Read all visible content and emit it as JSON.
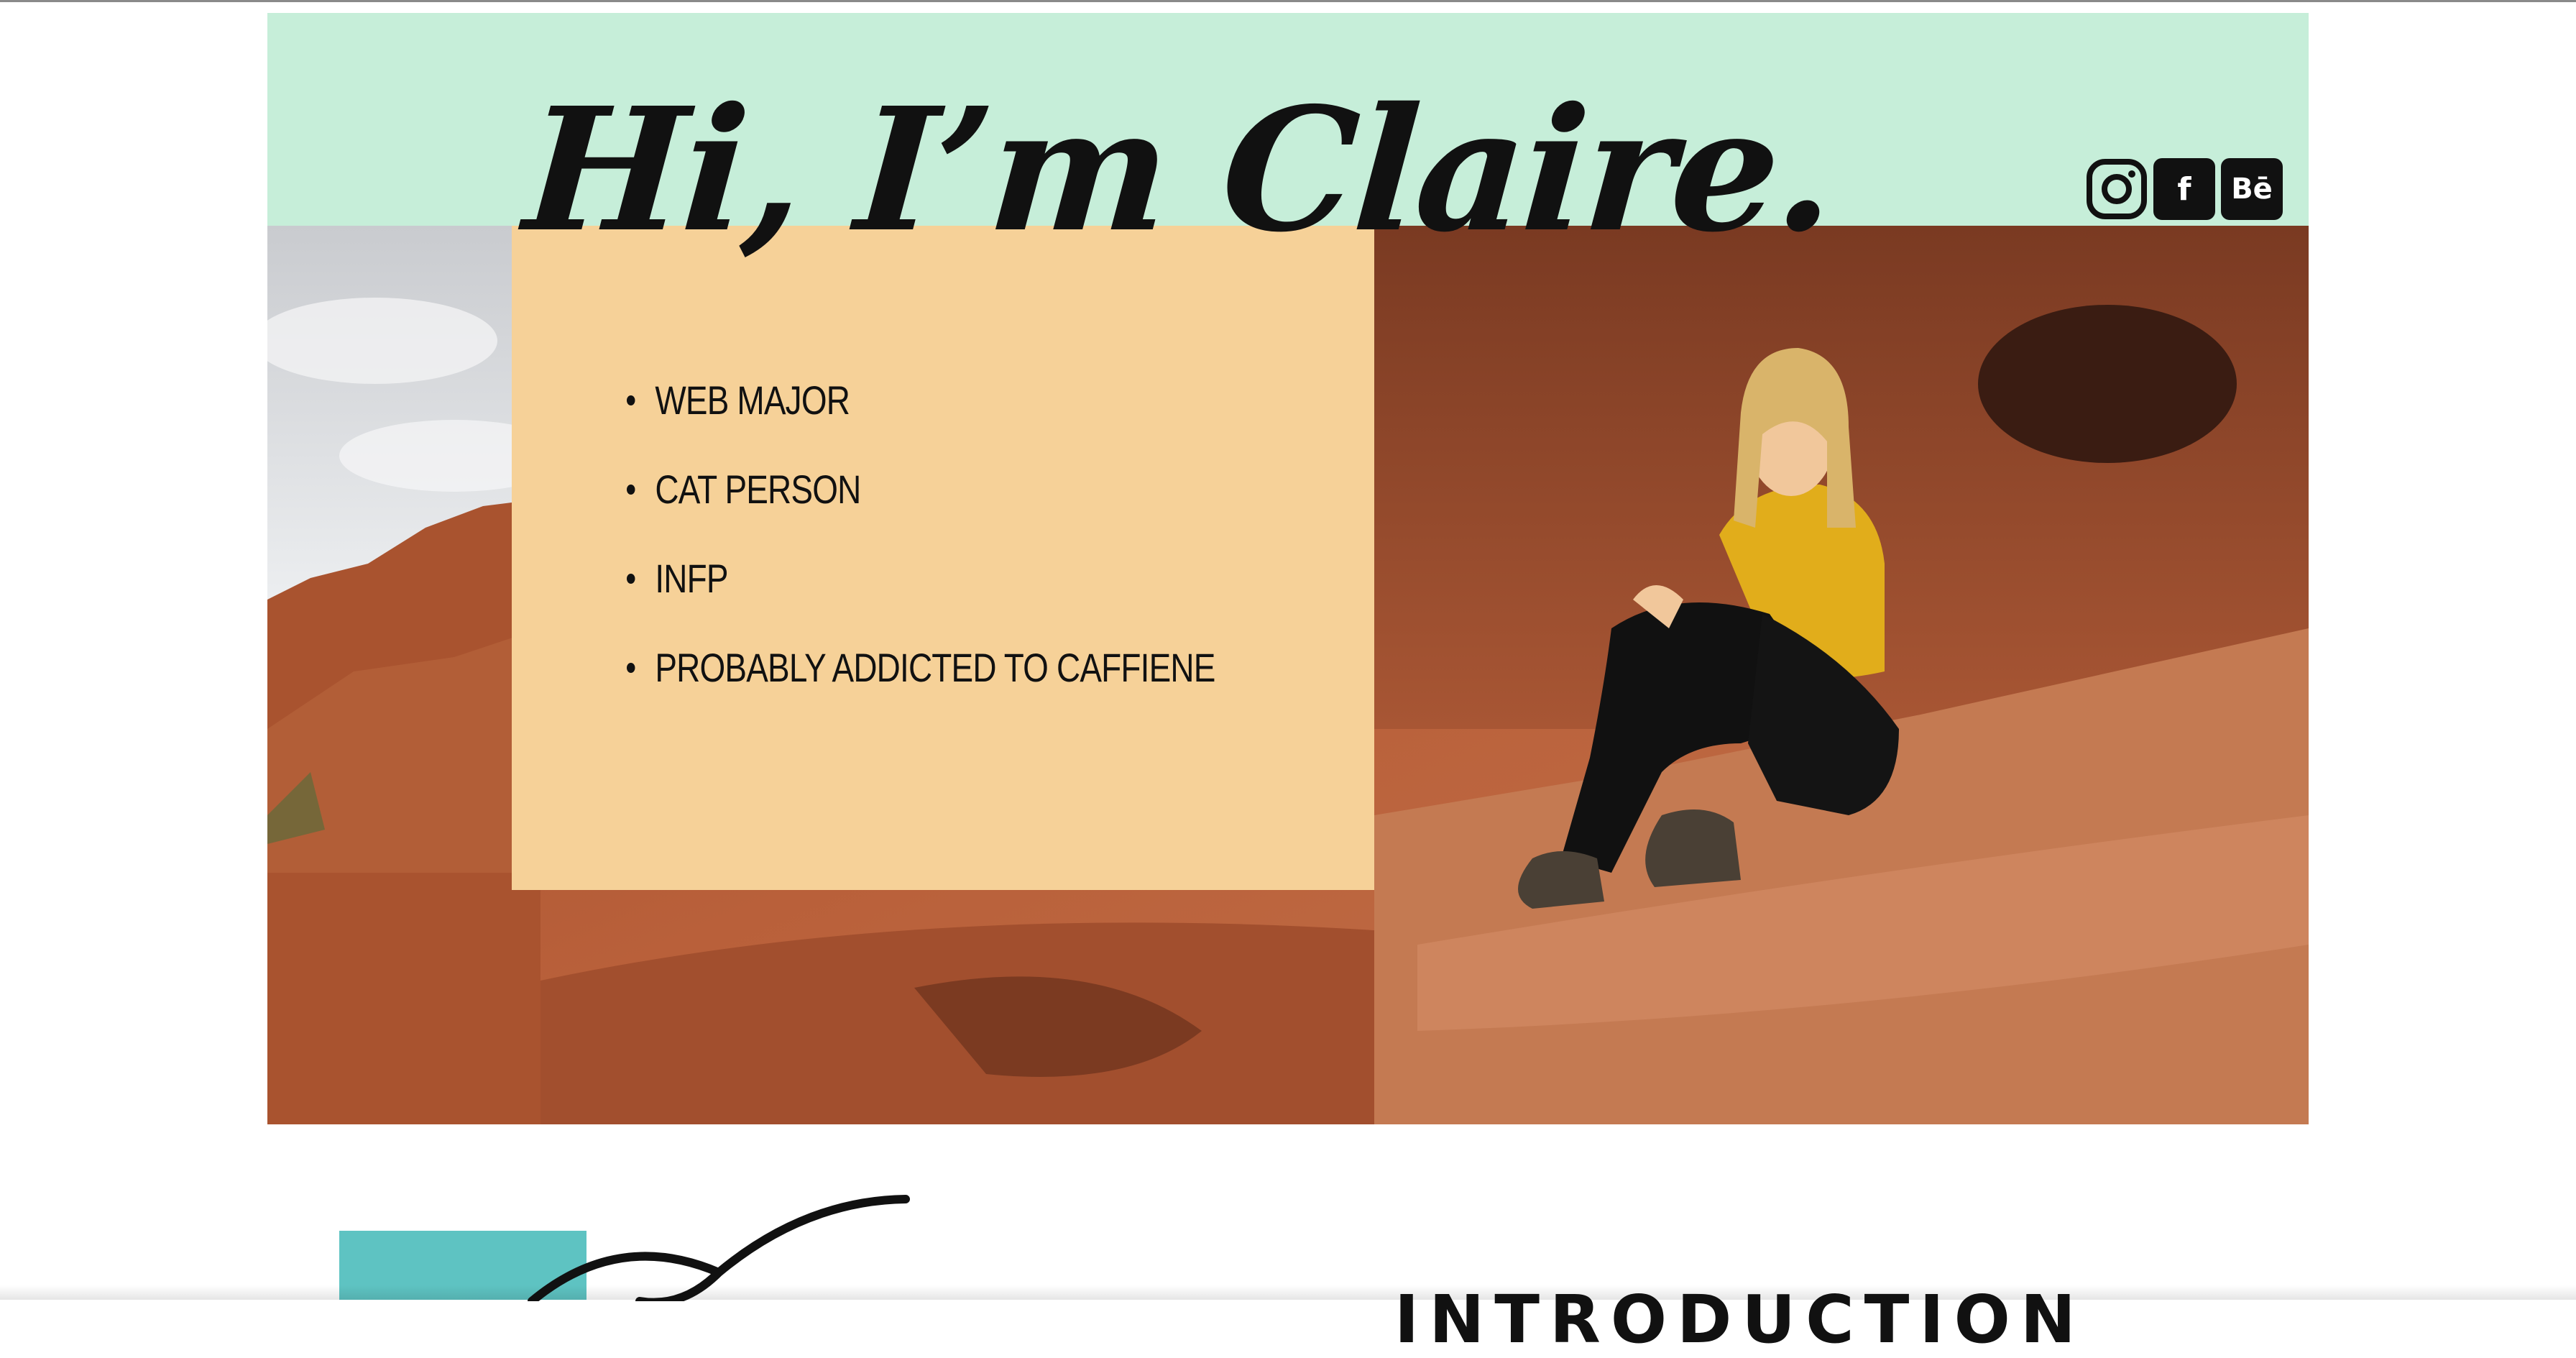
{
  "hero": {
    "title": "Hi, I’m Claire.",
    "facts": [
      "WEB MAJOR",
      "CAT PERSON",
      "INFP",
      "PROBABLY ADDICTED TO CAFFIENE"
    ],
    "photo_alt": "Claire sitting on red rocks wearing a yellow shirt and black leggings"
  },
  "social": {
    "items": [
      {
        "name": "instagram-icon",
        "label": ""
      },
      {
        "name": "facebook-icon",
        "label": "f"
      },
      {
        "name": "behance-icon",
        "label": "Bē"
      }
    ]
  },
  "intro": {
    "heading": "INTRODUCTION"
  },
  "colors": {
    "mint": "#c6eed9",
    "card": "#f6d198",
    "teal": "#5ec3c2",
    "text": "#111111",
    "rock": "#b85a34",
    "sky": "#dcdde0"
  }
}
